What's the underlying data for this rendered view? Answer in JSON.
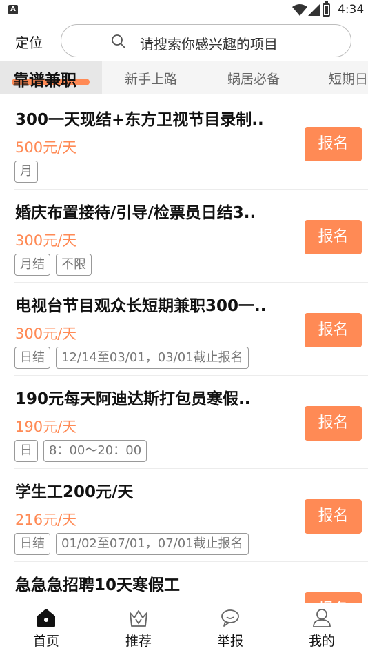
{
  "status_bar": {
    "time": "4:34",
    "app_badge": "A"
  },
  "header": {
    "location_label": "定位",
    "search_placeholder": "请搜索你感兴趣的项目"
  },
  "tabs": [
    {
      "label": "靠谱兼职",
      "active": true
    },
    {
      "label": "新手上路",
      "active": false
    },
    {
      "label": "蜗居必备",
      "active": false
    },
    {
      "label": "短期日",
      "active": false
    }
  ],
  "jobs": [
    {
      "title": "300一天现结+东方卫视节目录制..",
      "price": "500元/天",
      "tags": [
        "月"
      ],
      "button": "报名"
    },
    {
      "title": "婚庆布置接待/引导/检票员日结3..",
      "price": "300元/天",
      "tags": [
        "月结",
        "不限"
      ],
      "button": "报名"
    },
    {
      "title": "电视台节目观众长短期兼职300一..",
      "price": "300元/天",
      "tags": [
        "日结",
        "12/14至03/01，03/01截止报名"
      ],
      "button": "报名"
    },
    {
      "title": " 190元每天阿迪达斯打包员寒假..",
      "price": "190元/天",
      "tags": [
        "日",
        "8：00〜20：00"
      ],
      "button": "报名"
    },
    {
      "title": "学生工200元/天",
      "price": "216元/天",
      "tags": [
        "日结",
        "01/02至07/01，07/01截止报名"
      ],
      "button": "报名"
    },
    {
      "title": "急急急招聘10天寒假工",
      "price": "",
      "tags": [],
      "button": "报名"
    }
  ],
  "bottom_nav": [
    {
      "label": "首页",
      "icon": "home-icon",
      "active": true
    },
    {
      "label": "推荐",
      "icon": "crown-icon",
      "active": false
    },
    {
      "label": "举报",
      "icon": "chat-bubble-icon",
      "active": false
    },
    {
      "label": "我的",
      "icon": "user-icon",
      "active": false
    }
  ],
  "colors": {
    "accent": "#ff8a55",
    "tab_bar_bg": "#f5f5f5",
    "active_tab_bg": "#e7e7e7"
  }
}
